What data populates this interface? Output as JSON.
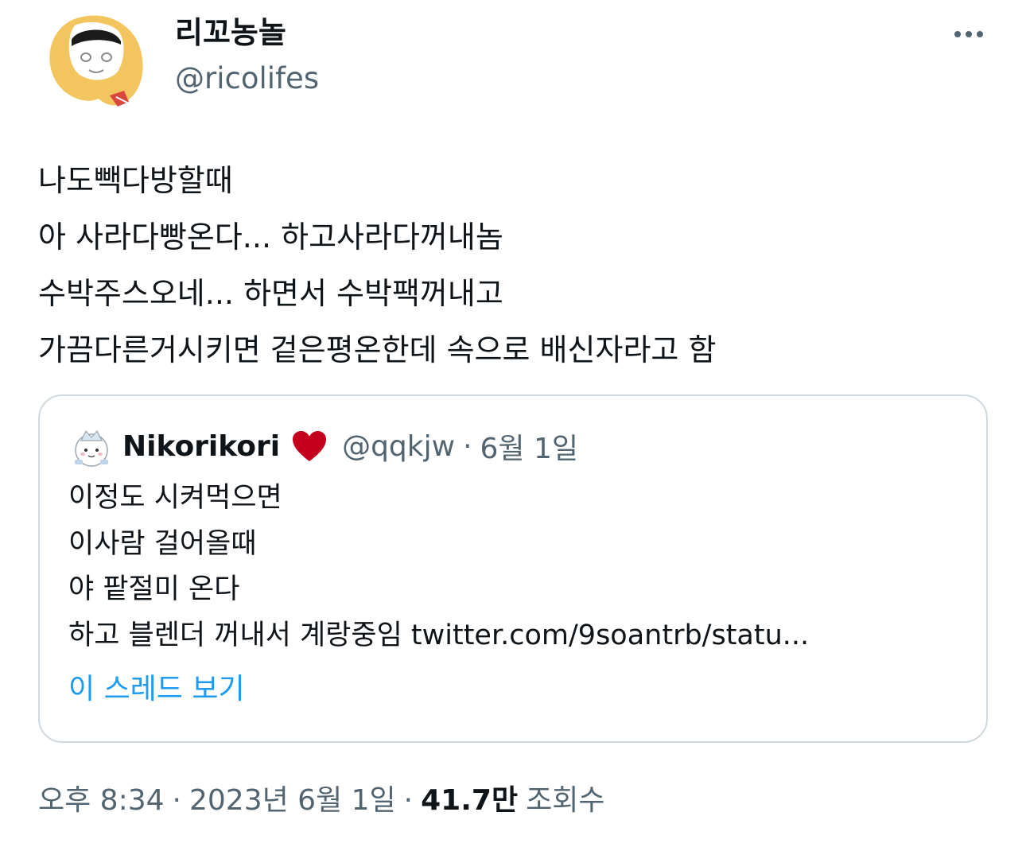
{
  "author": {
    "display_name": "리꼬농놀",
    "handle": "@ricolifes",
    "avatar_icon": "fried-shrimp-avatar-icon"
  },
  "more_icon": "ellipsis-icon",
  "tweet": {
    "lines": [
      "나도빽다방할때",
      "아 사라다빵온다... 하고사라다꺼내놈",
      "수박주스오네... 하면서 수박팩꺼내고",
      "가끔다른거시키면 겉은평온한데 속으로 배신자라고 함"
    ]
  },
  "quote": {
    "name": "Nikorikori",
    "heart_icon": "heart-icon",
    "handle": "@qqkjw",
    "separator": "·",
    "date": "6월 1일",
    "lines": [
      "이정도 시켜먹으면",
      "이사람 걸어올때",
      "야 팥절미 온다"
    ],
    "last_line_text": "하고 블렌더 꺼내서 계랑중임 ",
    "link": "twitter.com/9soantrb/statu...",
    "thread_link": "이 스레드 보기"
  },
  "footer": {
    "time": "오후 8:34",
    "separator": "·",
    "date": "2023년 6월 1일",
    "views_count": "41.7만",
    "views_label": "조회수"
  },
  "colors": {
    "text_primary": "#0f1419",
    "text_secondary": "#536471",
    "link_blue": "#1d9bf0",
    "border": "#cfd9de",
    "heart_red": "#c4001f"
  }
}
